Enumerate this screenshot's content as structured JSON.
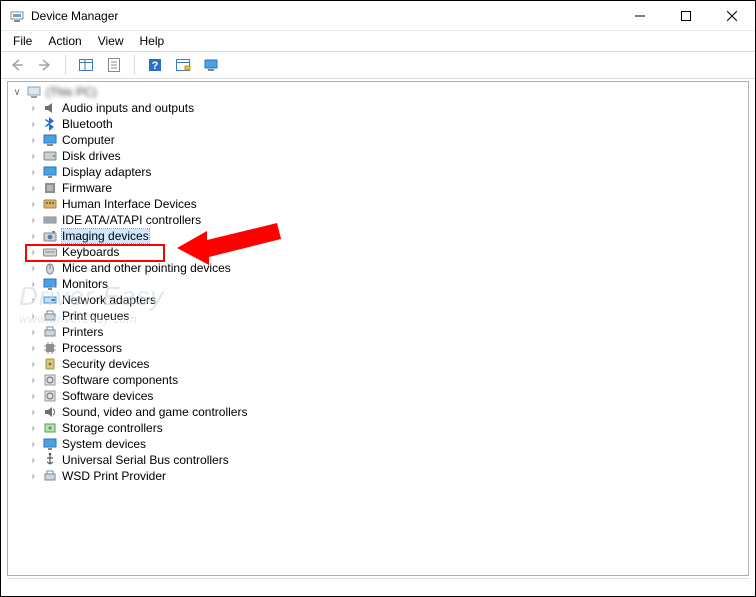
{
  "window": {
    "title": "Device Manager"
  },
  "menu": {
    "file": "File",
    "action": "Action",
    "view": "View",
    "help": "Help"
  },
  "tree": {
    "root": "(This PC)",
    "items": [
      {
        "id": "audio",
        "label": "Audio inputs and outputs"
      },
      {
        "id": "bluetooth",
        "label": "Bluetooth"
      },
      {
        "id": "computer",
        "label": "Computer"
      },
      {
        "id": "disk",
        "label": "Disk drives"
      },
      {
        "id": "display",
        "label": "Display adapters"
      },
      {
        "id": "firmware",
        "label": "Firmware"
      },
      {
        "id": "hid",
        "label": "Human Interface Devices"
      },
      {
        "id": "ide",
        "label": "IDE ATA/ATAPI controllers"
      },
      {
        "id": "imaging",
        "label": "Imaging devices",
        "selected": true
      },
      {
        "id": "keyboards",
        "label": "Keyboards"
      },
      {
        "id": "mice",
        "label": "Mice and other pointing devices"
      },
      {
        "id": "monitors",
        "label": "Monitors"
      },
      {
        "id": "network",
        "label": "Network adapters"
      },
      {
        "id": "printq",
        "label": "Print queues"
      },
      {
        "id": "printers",
        "label": "Printers"
      },
      {
        "id": "processors",
        "label": "Processors"
      },
      {
        "id": "security",
        "label": "Security devices"
      },
      {
        "id": "swcomp",
        "label": "Software components"
      },
      {
        "id": "swdev",
        "label": "Software devices"
      },
      {
        "id": "sound",
        "label": "Sound, video and game controllers"
      },
      {
        "id": "storage",
        "label": "Storage controllers"
      },
      {
        "id": "system",
        "label": "System devices"
      },
      {
        "id": "usb",
        "label": "Universal Serial Bus controllers"
      },
      {
        "id": "wsd",
        "label": "WSD Print Provider"
      }
    ]
  },
  "watermark": {
    "line1": "Driver Easy",
    "line2": "www.drivereasy.com"
  },
  "colors": {
    "highlight": "#ff0000",
    "selection": "#cde8ff"
  }
}
